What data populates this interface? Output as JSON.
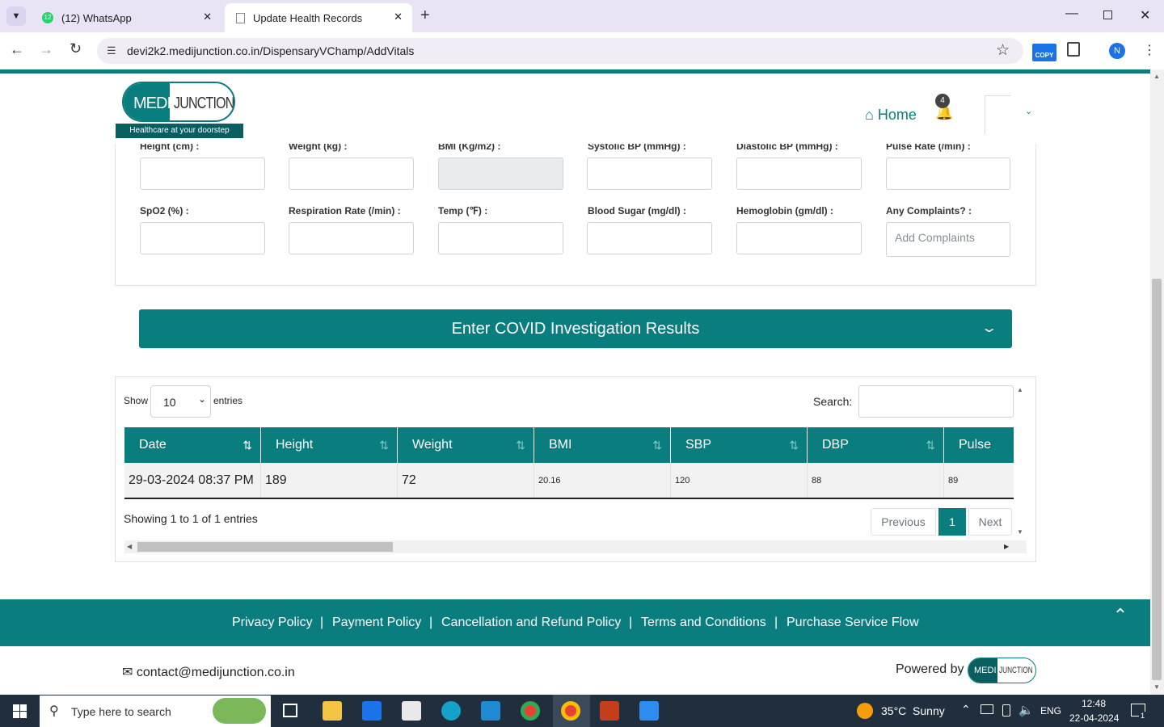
{
  "browser": {
    "tabs": [
      {
        "label": "(12) WhatsApp",
        "badge": "12"
      },
      {
        "label": "Update Health Records"
      }
    ],
    "url": "devi2k2.medijunction.co.in/DispensaryVChamp/AddVitals",
    "profile_initial": "N",
    "copy_ext": "COPY"
  },
  "header": {
    "logo_text_left": "MEDI",
    "logo_text_right": "JUNCTION",
    "logo_tagline": "Healthcare at your  doorstep",
    "home_label": "Home",
    "notification_count": "4"
  },
  "vitals": {
    "row1": [
      "Height (cm) :",
      "Weight (kg) :",
      "BMI (Kg/m2) :",
      "Systolic BP (mmHg) :",
      "Diastolic BP (mmHg) :",
      "Pulse Rate (/min) :"
    ],
    "row2": [
      "SpO2 (%) :",
      "Respiration Rate (/min) :",
      "Temp (℉) :",
      "Blood Sugar (mg/dl) :",
      "Hemoglobin (gm/dl) :",
      "Any Complaints? :"
    ],
    "complaints_placeholder": "Add Complaints"
  },
  "covid_bar": {
    "label": "Enter COVID Investigation Results"
  },
  "table": {
    "show_label": "Show",
    "entries_label": "entries",
    "page_size": "10",
    "search_label": "Search:",
    "columns": [
      "Date",
      "Height",
      "Weight",
      "BMI",
      "SBP",
      "DBP",
      "Pulse"
    ],
    "rows": [
      [
        "29-03-2024 08:37 PM",
        "189",
        "72",
        "20.16",
        "120",
        "88",
        "89"
      ]
    ],
    "info": "Showing 1 to 1 of 1 entries",
    "prev_label": "Previous",
    "current_page": "1",
    "next_label": "Next"
  },
  "footer": {
    "links": [
      "Privacy Policy",
      "Payment Policy",
      "Cancellation and Refund Policy",
      "Terms and Conditions",
      "Purchase Service Flow"
    ],
    "email": "contact@medijunction.co.in",
    "powered_by": "Powered by"
  },
  "taskbar": {
    "search_placeholder": "Type here to search",
    "weather": "35°C  Sunny",
    "language": "ENG",
    "time": "12:48",
    "date": "22-04-2024",
    "notif_count": "1"
  },
  "colors": {
    "primary": "#0a7d7e",
    "tab_bg": "#e9e3f5",
    "taskbar": "#202e3e"
  }
}
